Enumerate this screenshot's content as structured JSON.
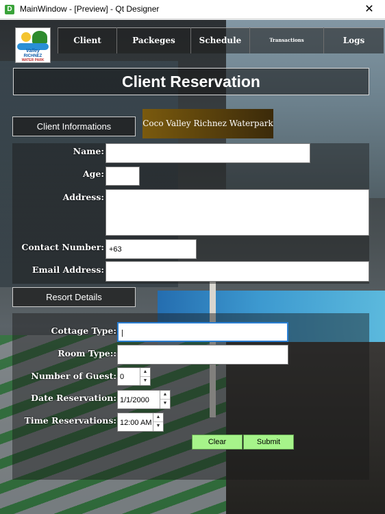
{
  "window": {
    "title": "MainWindow - [Preview] - Qt Designer",
    "app_icon": "D",
    "close": "✕"
  },
  "logo": {
    "line1": "Valley",
    "line2": "RICHNEZ",
    "line3": "WATER PARK"
  },
  "nav": {
    "client": "Client",
    "packages": "Packeges",
    "schedule": "Schedule",
    "transactions": "Transactions",
    "logs": "Logs"
  },
  "header": {
    "title": "Client Reservation"
  },
  "client_section": {
    "button": "Client Informations",
    "brand": "Coco Valley Richnez Waterpark",
    "name_label": "Name:",
    "name_value": "",
    "age_label": "Age:",
    "age_value": "",
    "address_label": "Address:",
    "address_value": "",
    "contact_label": "Contact Number:",
    "contact_value": "+63",
    "email_label": "Email Address:",
    "email_value": ""
  },
  "resort_section": {
    "button": "Resort Details",
    "cottage_label": "Cottage Type:",
    "cottage_value": "|",
    "room_label": "Room Type::",
    "room_value": "",
    "guests_label": "Number of Guest:",
    "guests_value": "0",
    "date_label": "Date Reservation:",
    "date_value": "1/1/2000",
    "time_label": "Time Reservations:",
    "time_value": "12:00 AM"
  },
  "actions": {
    "clear": "Clear",
    "submit": "Submit"
  },
  "colors": {
    "accent_green": "#a6f48a",
    "focus_blue": "#2a7fd4",
    "brand_gold": "#7a5a0e"
  },
  "icons": {
    "up": "▲",
    "down": "▼"
  }
}
